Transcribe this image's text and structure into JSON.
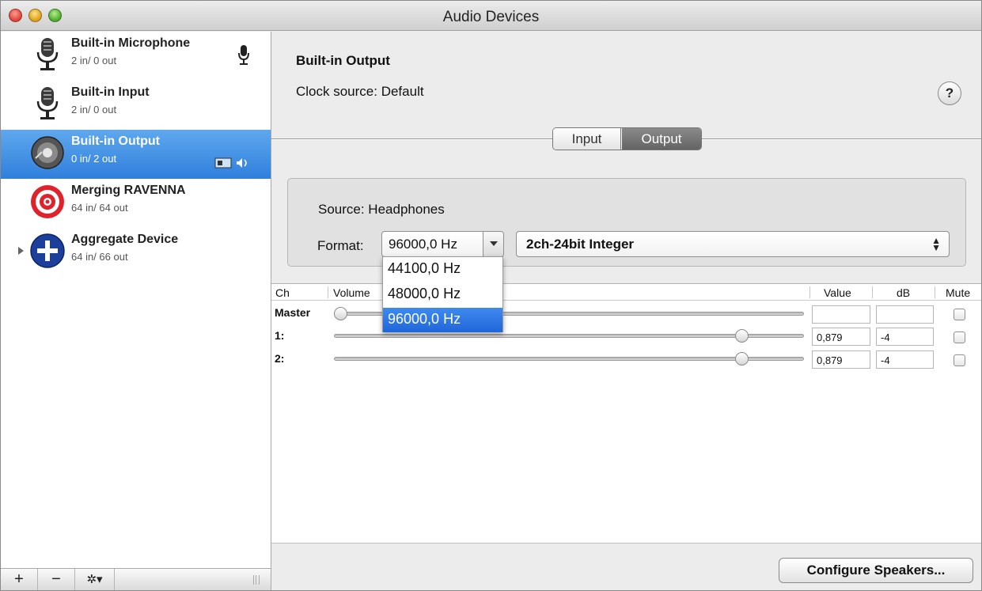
{
  "window": {
    "title": "Audio Devices"
  },
  "sidebar": {
    "devices": [
      {
        "name": "Built-in Microphone",
        "io": "2 in/ 0 out",
        "icon": "microphone-icon",
        "badge": "microphone-badge-icon"
      },
      {
        "name": "Built-in Input",
        "io": "2 in/ 0 out",
        "icon": "microphone-icon"
      },
      {
        "name": "Built-in Output",
        "io": "0 in/ 2 out",
        "icon": "speaker-icon",
        "selected": true,
        "badge": "system-output-badge-icon"
      },
      {
        "name": "Merging RAVENNA",
        "io": "64 in/ 64 out",
        "icon": "target-icon"
      },
      {
        "name": "Aggregate Device",
        "io": "64 in/ 66 out",
        "icon": "plus-circle-icon"
      }
    ],
    "bottom_buttons": {
      "add": "+",
      "remove": "−",
      "action": "✲▾"
    }
  },
  "main": {
    "device_title": "Built-in Output",
    "clock_source": "Clock source:  Default",
    "help_label": "?",
    "tabs": [
      {
        "label": "Input",
        "active": false
      },
      {
        "label": "Output",
        "active": true
      }
    ],
    "source_label": "Source:  Headphones",
    "format_label": "Format:",
    "sample_rate": "96000,0 Hz",
    "bit_format": "2ch-24bit Integer",
    "sample_rate_options": [
      "44100,0 Hz",
      "48000,0 Hz",
      "96000,0 Hz"
    ],
    "table": {
      "headers": {
        "ch": "Ch",
        "volume": "Volume",
        "value": "Value",
        "db": "dB",
        "mute": "Mute"
      },
      "rows": [
        {
          "label": "Master",
          "volume": 0.0,
          "value": "",
          "db": ""
        },
        {
          "label": "1:",
          "volume": 0.879,
          "value": "0,879",
          "db": "-4"
        },
        {
          "label": "2:",
          "volume": 0.879,
          "value": "0,879",
          "db": "-4"
        }
      ]
    },
    "configure_button": "Configure Speakers..."
  },
  "colors": {
    "selection": "#3a86e4",
    "target_red": "#e0222b",
    "plus_blue": "#1c3f9c"
  }
}
